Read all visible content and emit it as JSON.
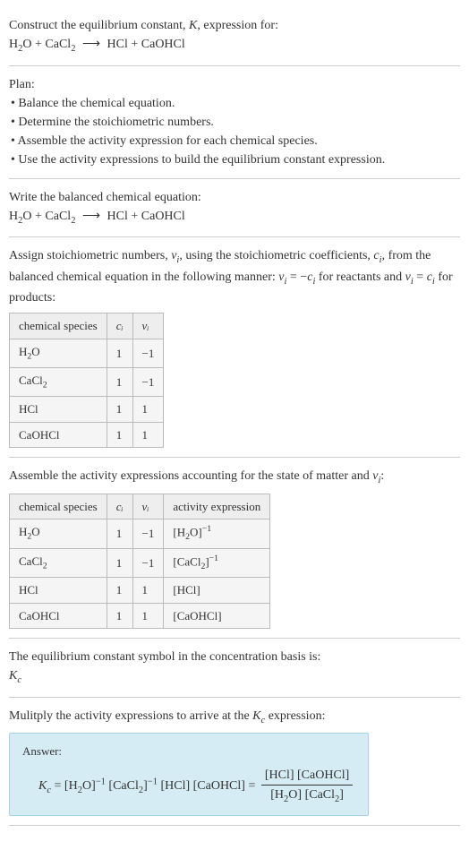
{
  "intro": {
    "line1_prefix": "Construct the equilibrium constant, ",
    "line1_K": "K",
    "line1_suffix": ", expression for:",
    "equation_lhs1": "H",
    "equation_lhs1_sub": "2",
    "equation_lhs1_tail": "O",
    "equation_plus": " + ",
    "equation_lhs2": "CaCl",
    "equation_lhs2_sub": "2",
    "equation_arrow": "⟶",
    "equation_rhs1": "HCl",
    "equation_rhs2": "CaOHCl"
  },
  "plan": {
    "heading": "Plan:",
    "items": [
      "Balance the chemical equation.",
      "Determine the stoichiometric numbers.",
      "Assemble the activity expression for each chemical species.",
      "Use the activity expressions to build the equilibrium constant expression."
    ]
  },
  "balanced": {
    "heading": "Write the balanced chemical equation:"
  },
  "stoich": {
    "text_a": "Assign stoichiometric numbers, ",
    "nu_i": "ν",
    "nu_i_sub": "i",
    "text_b": ", using the stoichiometric coefficients, ",
    "c_i": "c",
    "c_i_sub": "i",
    "text_c": ", from the balanced chemical equation in the following manner: ",
    "rel1_a": "ν",
    "rel1_b": "i",
    "rel1_eq": " = −",
    "rel1_c": "c",
    "rel1_d": "i",
    "text_d": " for reactants and ",
    "rel2_a": "ν",
    "rel2_b": "i",
    "rel2_eq": " = ",
    "rel2_c": "c",
    "rel2_d": "i",
    "text_e": " for products:",
    "headers": [
      "chemical species",
      "cᵢ",
      "νᵢ"
    ],
    "rows": [
      {
        "species_a": "H",
        "species_sub": "2",
        "species_b": "O",
        "c": "1",
        "nu": "−1"
      },
      {
        "species_a": "CaCl",
        "species_sub": "2",
        "species_b": "",
        "c": "1",
        "nu": "−1"
      },
      {
        "species_a": "HCl",
        "species_sub": "",
        "species_b": "",
        "c": "1",
        "nu": "1"
      },
      {
        "species_a": "CaOHCl",
        "species_sub": "",
        "species_b": "",
        "c": "1",
        "nu": "1"
      }
    ]
  },
  "activity": {
    "heading_a": "Assemble the activity expressions accounting for the state of matter and ",
    "heading_nu": "ν",
    "heading_nu_sub": "i",
    "heading_b": ":",
    "headers": [
      "chemical species",
      "cᵢ",
      "νᵢ",
      "activity expression"
    ],
    "rows": [
      {
        "species_a": "H",
        "species_sub": "2",
        "species_b": "O",
        "c": "1",
        "nu": "−1",
        "act_a": "[H",
        "act_sub": "2",
        "act_b": "O]",
        "act_sup": "−1"
      },
      {
        "species_a": "CaCl",
        "species_sub": "2",
        "species_b": "",
        "c": "1",
        "nu": "−1",
        "act_a": "[CaCl",
        "act_sub": "2",
        "act_b": "]",
        "act_sup": "−1"
      },
      {
        "species_a": "HCl",
        "species_sub": "",
        "species_b": "",
        "c": "1",
        "nu": "1",
        "act_a": "[HCl]",
        "act_sub": "",
        "act_b": "",
        "act_sup": ""
      },
      {
        "species_a": "CaOHCl",
        "species_sub": "",
        "species_b": "",
        "c": "1",
        "nu": "1",
        "act_a": "[CaOHCl]",
        "act_sub": "",
        "act_b": "",
        "act_sup": ""
      }
    ]
  },
  "kc_symbol": {
    "line1": "The equilibrium constant symbol in the concentration basis is:",
    "line2_a": "K",
    "line2_sub": "c"
  },
  "multiply": {
    "text_a": "Mulitply the activity expressions to arrive at the ",
    "k": "K",
    "k_sub": "c",
    "text_b": " expression:"
  },
  "answer": {
    "label": "Answer:",
    "k": "K",
    "k_sub": "c",
    "eq": " = ",
    "t1_a": "[H",
    "t1_sub": "2",
    "t1_b": "O]",
    "t1_sup": "−1",
    "sp": " ",
    "t2_a": "[CaCl",
    "t2_sub": "2",
    "t2_b": "]",
    "t2_sup": "−1",
    "t3": "[HCl]",
    "t4": "[CaOHCl]",
    "eq2": " = ",
    "num": "[HCl] [CaOHCl]",
    "den_a": "[H",
    "den_sub1": "2",
    "den_b": "O] [CaCl",
    "den_sub2": "2",
    "den_c": "]"
  }
}
